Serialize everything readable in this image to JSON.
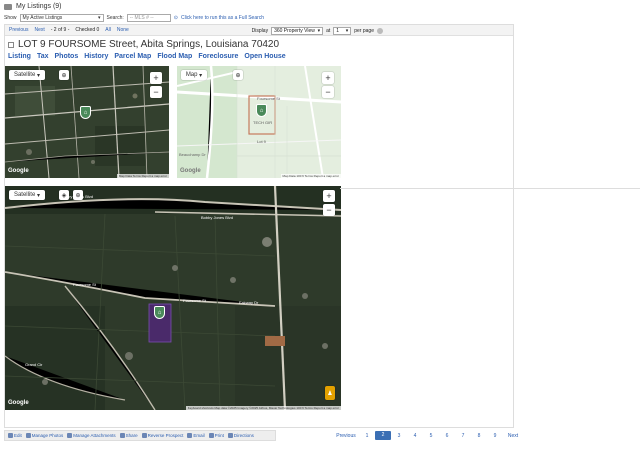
{
  "header": {
    "title": "My Listings (9)",
    "show_label": "Show",
    "show_value": "My Active Listings",
    "search_label": "Search:",
    "search_placeholder": "-- MLS # --",
    "search_link": "Click here to run this as a Full Search"
  },
  "nav": {
    "previous": "Previous",
    "next": "Next",
    "position": "- 2 of 9 -",
    "checked": "Checked 0",
    "all": "All",
    "none": "None",
    "display_label": "Display",
    "display_value": "360 Property View",
    "at_label": "at",
    "at_value": "1",
    "per_page": "per page"
  },
  "listing": {
    "address": "LOT 9 FOURSOME Street, Abita Springs, Louisiana 70420"
  },
  "tabs": [
    "Listing",
    "Tax",
    "Photos",
    "History",
    "Parcel Map",
    "Flood Map",
    "Foreclosure",
    "Open House"
  ],
  "maps": {
    "top_left": {
      "type_label": "Satellite",
      "attribution": "Map Data  Terms  Report a map error"
    },
    "top_right": {
      "type_label": "Map",
      "attribution": "Map Data  100 ft  Terms  Report a map error",
      "street_1": "Bobby Jones Blvd",
      "street_2": "Foursome St",
      "street_3": "Fairway Dr",
      "lot_label": "TECH GIR",
      "lot_label_2": "Lot 9",
      "road": "Kuemps Dr",
      "other": "Beauchamp Dr"
    },
    "large": {
      "type_label": "Satellite",
      "attribution": "Keyboard shortcuts  Map data ©2025 Imagery ©2025 Airbus, Maxar Technologies  100 ft  Terms  Report a map error",
      "street_1": "Bobby Jones Blvd",
      "street_2": "Bobby Jones Blvd",
      "street_3": "Foursome St",
      "street_4": "Foursome St",
      "street_5": "Fairway Dr",
      "street_6": "Grand Cir"
    },
    "google": "Google"
  },
  "toolbar": [
    "Edit",
    "Manage Photos",
    "Manage Attachments",
    "Share",
    "Reverse Prospect",
    "Email",
    "Print",
    "Directions"
  ],
  "pager": {
    "previous": "Previous",
    "pages": [
      "1",
      "2",
      "3",
      "4",
      "5",
      "6",
      "7",
      "8",
      "9"
    ],
    "active": "2",
    "next": "Next"
  },
  "colors": {
    "link": "#2a5db0",
    "active_page": "#3b6fb4",
    "marker": "#4a8a5a"
  }
}
